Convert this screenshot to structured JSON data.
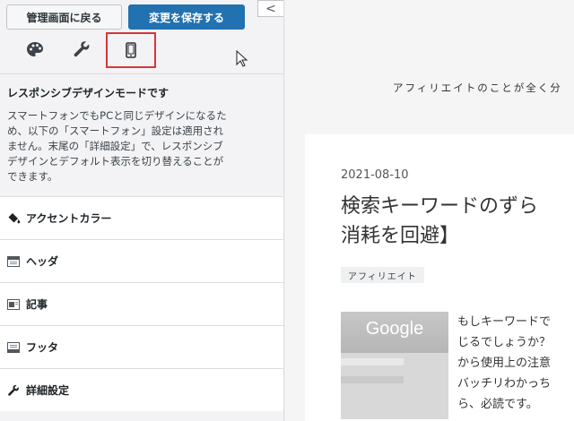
{
  "toolbar": {
    "back_label": "管理画面に戻る",
    "save_label": "変更を保存する",
    "collapse_label": "<"
  },
  "device_tabs": [
    "palette-icon",
    "wrench-icon",
    "mobile-icon"
  ],
  "info": {
    "title": "レスポンシブデザインモードです",
    "lines": [
      "スマートフォンでもPCと同じデザインになるた",
      "め、以下の「スマートフォン」設定は適用され",
      "ません。末尾の「詳細設定」で、レスポンシブ",
      "デザインとデフォルト表示を切り替えることが",
      "できます。"
    ]
  },
  "menu": [
    {
      "label": "アクセントカラー",
      "icon": "paint-bucket-icon"
    },
    {
      "label": "ヘッダ",
      "icon": "header-layout-icon"
    },
    {
      "label": "記事",
      "icon": "article-layout-icon"
    },
    {
      "label": "フッタ",
      "icon": "footer-layout-icon"
    },
    {
      "label": "詳細設定",
      "icon": "wrench-icon"
    }
  ],
  "preview": {
    "site_description": "アフィリエイトのことが全く分",
    "post_date": "2021-08-10",
    "post_title_line1": "検索キーワードのずら",
    "post_title_line2": "消耗を回避】",
    "category": "アフィリエイト",
    "thumb_logo": "Google",
    "excerpt": "もしキーワードで\nじるでしょうか？\nから使用上の注意\nバッチリわかっち\nら、必読です。"
  },
  "colors": {
    "accent": "#2271b1",
    "highlight": "#d63638"
  }
}
